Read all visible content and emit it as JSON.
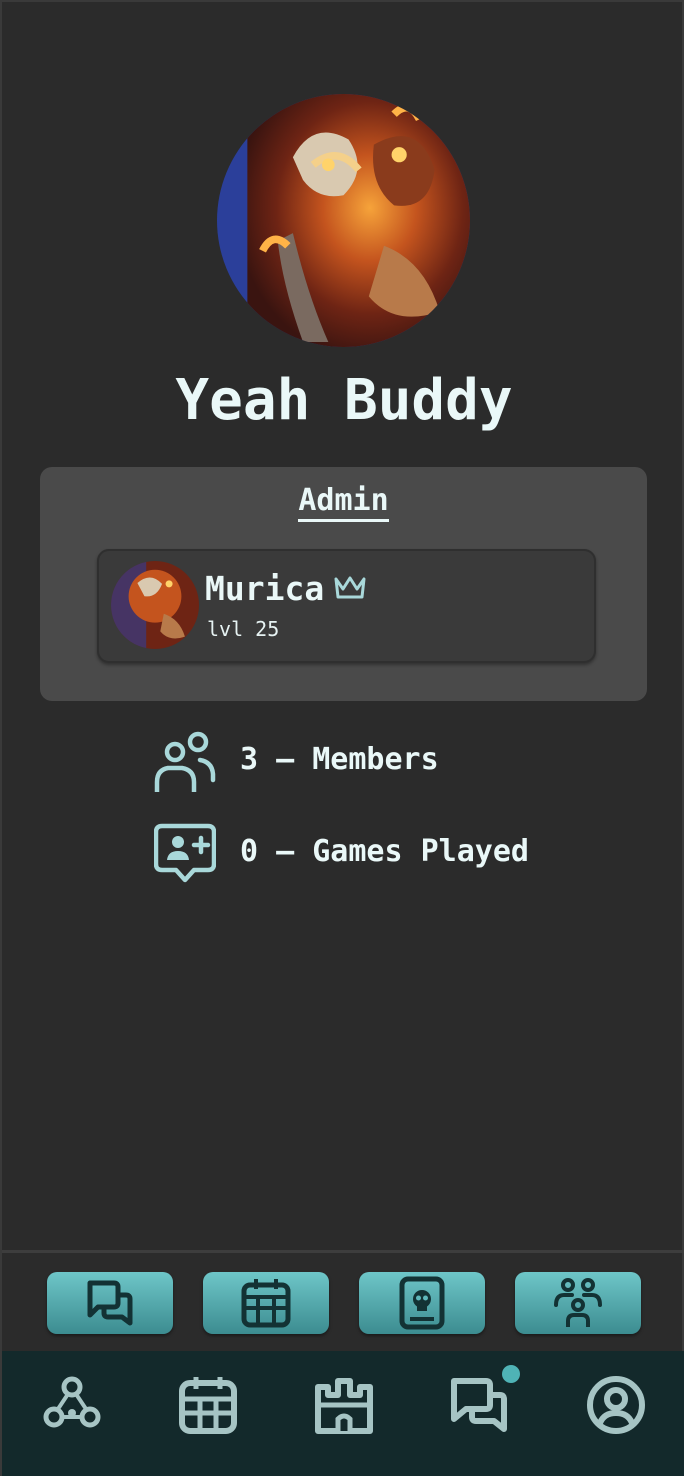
{
  "group": {
    "name": "Yeah Buddy"
  },
  "admin_section": {
    "title": "Admin",
    "member": {
      "name": "Murica",
      "level": "lvl 25",
      "crown_icon": "crown-icon"
    }
  },
  "stats": [
    {
      "icon": "users-icon",
      "label": "3 – Members"
    },
    {
      "icon": "user-chat-plus-icon",
      "label": "0 – Games Played"
    }
  ],
  "action_bar": [
    {
      "icon": "messages-icon"
    },
    {
      "icon": "calendar-icon"
    },
    {
      "icon": "skull-book-icon"
    },
    {
      "icon": "group-icon"
    }
  ],
  "nav_bar": [
    {
      "icon": "hub-icon"
    },
    {
      "icon": "calendar-icon"
    },
    {
      "icon": "castle-icon"
    },
    {
      "icon": "messages-icon",
      "notification": true
    },
    {
      "icon": "profile-icon"
    }
  ],
  "colors": {
    "background": "#2b2b2b",
    "card": "#4a4a4a",
    "accent": "#5fb8bb",
    "navbar": "#13292b",
    "text": "#eaf8f8"
  }
}
